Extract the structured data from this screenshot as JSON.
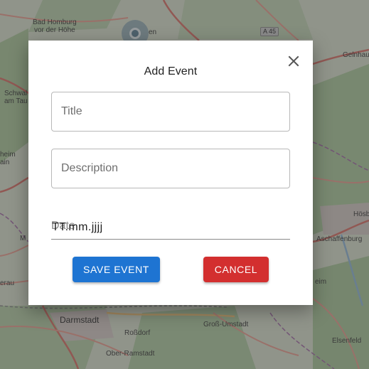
{
  "map": {
    "places": {
      "bad_homburg": "Bad Homburg\nvor der Höhe",
      "marker_town": "en",
      "gelnhausen": "Gelnhau",
      "schwalbach": "Schwal\nam Tau",
      "heim": "heim\nain",
      "hoesbach": "Hösb",
      "aschaffenburg": "Aschaffenburg",
      "eisheim": "eim",
      "gerau": "erau",
      "m_left": "M",
      "darmstadt": "Darmstadt",
      "rossdorf": "Roßdorf",
      "gross_umstadt": "Groß-Umstadt",
      "elsenfeld": "Elsenfeld",
      "ober_ramstadt": "Ober-Ramstadt"
    },
    "road_shield": "A 45"
  },
  "dialog": {
    "title": "Add Event",
    "close_icon": "close-icon",
    "title_field": {
      "placeholder": "Title",
      "value": ""
    },
    "description_field": {
      "placeholder": "Description",
      "value": ""
    },
    "date_field": {
      "label": "Date",
      "value": "TT.mm.jjjj"
    },
    "save_label": "Save Event",
    "cancel_label": "Cancel"
  },
  "colors": {
    "save": "#1e74d2",
    "cancel": "#d32f2f",
    "overlay": "rgba(60,60,60,0.45)"
  }
}
